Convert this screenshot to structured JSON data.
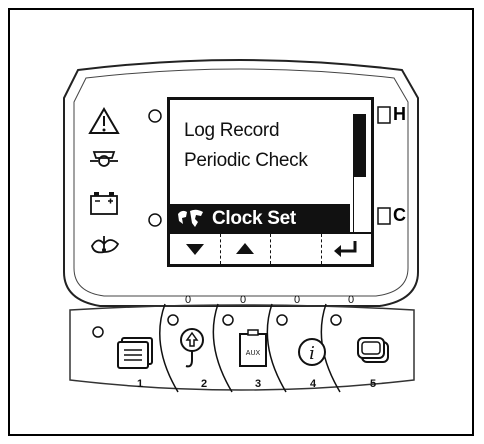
{
  "lcd": {
    "menu_items": [
      "Log Record",
      "Periodic Check"
    ],
    "selected_item": "Clock Set",
    "scroll_fraction": 0.5
  },
  "softkeys": [
    {
      "icon": "arrow-down-icon"
    },
    {
      "icon": "arrow-up-icon"
    },
    {
      "icon": "blank"
    },
    {
      "icon": "enter-icon"
    }
  ],
  "indicators": {
    "right": [
      "H",
      "C"
    ],
    "left": [
      "warning-icon",
      "oil-pressure-icon",
      "battery-icon",
      "coolant-temperature-icon"
    ]
  },
  "buttons": [
    {
      "number": "1",
      "led": "",
      "icon": "document-icon"
    },
    {
      "number": "2",
      "led": "0",
      "icon": "hook-icon"
    },
    {
      "number": "3",
      "led": "0",
      "icon": "aux-icon"
    },
    {
      "number": "4",
      "led": "0",
      "icon": "info-icon"
    },
    {
      "number": "5",
      "led": "0",
      "icon": "screens-icon"
    }
  ]
}
